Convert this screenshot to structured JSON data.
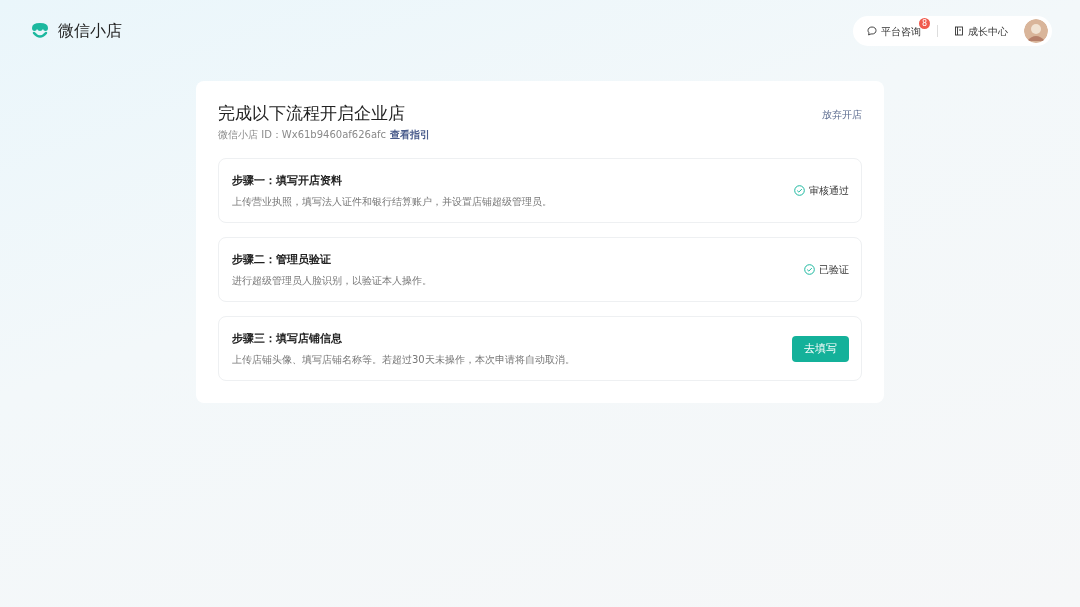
{
  "brand": {
    "name": "微信小店"
  },
  "header": {
    "consult": {
      "label": "平台咨询",
      "badge": "8"
    },
    "growth": {
      "label": "成长中心"
    }
  },
  "page": {
    "title": "完成以下流程开启企业店",
    "abandon_link": "放弃开店",
    "shop_id_label": "微信小店 ID：Wx61b9460af626afc",
    "guide_link": "查看指引"
  },
  "steps": [
    {
      "title": "步骤一：填写开店资料",
      "description": "上传营业执照，填写法人证件和银行结算账户，并设置店铺超级管理员。",
      "kind": "status",
      "status": "审核通过"
    },
    {
      "title": "步骤二：管理员验证",
      "description": "进行超级管理员人脸识别，以验证本人操作。",
      "kind": "status",
      "status": "已验证"
    },
    {
      "title": "步骤三：填写店铺信息",
      "description": "上传店铺头像、填写店铺名称等。若超过30天未操作，本次申请将自动取消。",
      "kind": "action",
      "action": "去填写"
    }
  ]
}
